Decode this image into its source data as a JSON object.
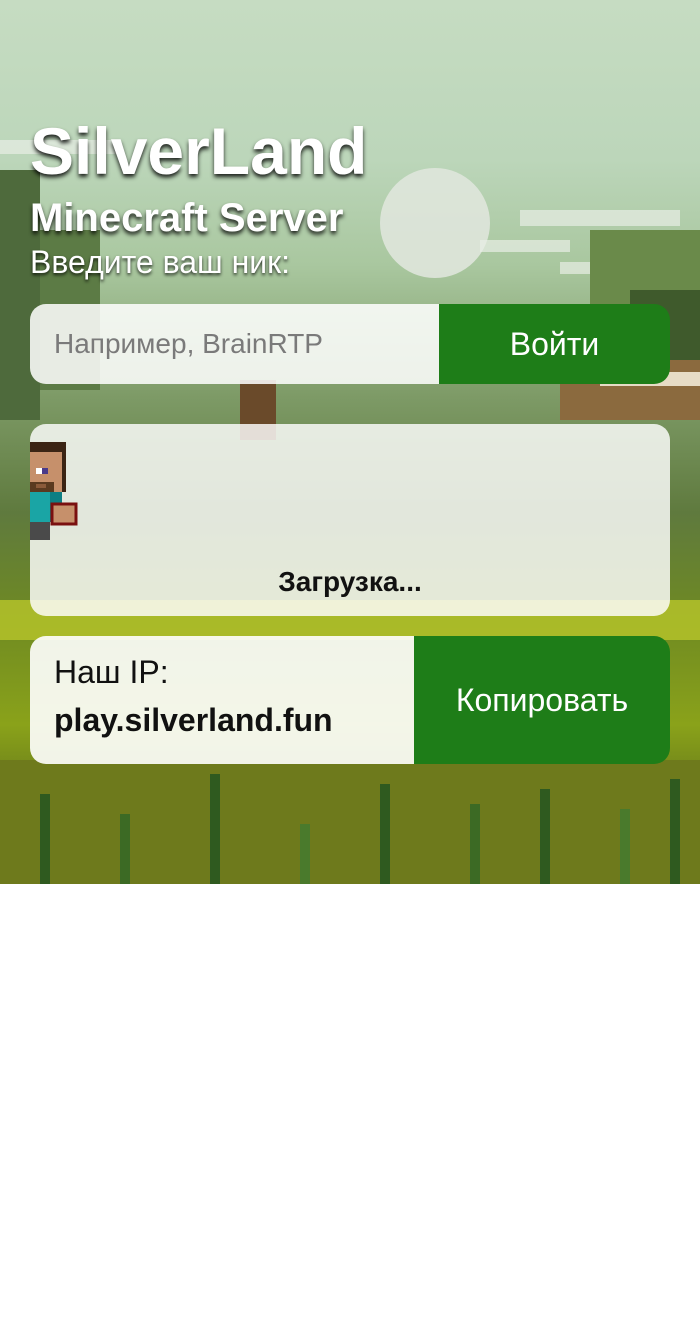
{
  "header": {
    "title": "SilverLand",
    "subtitle": "Minecraft Server",
    "prompt": "Введите ваш ник:"
  },
  "login": {
    "placeholder": "Например, BrainRTP",
    "value": "",
    "button_label": "Войти"
  },
  "loading": {
    "text": "Загрузка...",
    "character_icon": "steve-icon"
  },
  "server_ip": {
    "label": "Наш IP:",
    "address": "play.silverland.fun",
    "copy_label": "Копировать"
  },
  "colors": {
    "accent_green": "#1e7d18",
    "text_white": "#ffffff"
  }
}
